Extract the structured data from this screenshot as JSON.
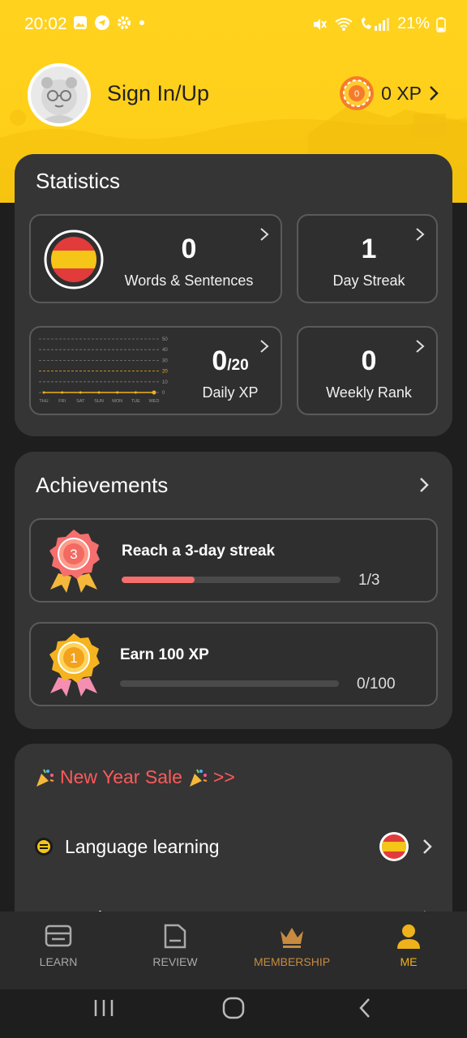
{
  "status_bar": {
    "time": "20:02",
    "battery": "21%"
  },
  "profile": {
    "sign_in_label": "Sign In/Up",
    "xp_label": "0 XP",
    "coin_value": "0"
  },
  "statistics": {
    "title": "Statistics",
    "words": {
      "value": "0",
      "label": "Words & Sentences"
    },
    "streak": {
      "value": "1",
      "label": "Day Streak"
    },
    "daily_xp": {
      "value": "0",
      "goal": "/20",
      "label": "Daily XP"
    },
    "weekly_rank": {
      "value": "0",
      "label": "Weekly Rank"
    },
    "mini_chart": {
      "y_ticks": [
        "50",
        "40",
        "30",
        "20",
        "10",
        "0"
      ],
      "x_days": [
        "THU",
        "FRI",
        "SAT",
        "SUN",
        "MON",
        "TUE",
        "WED"
      ],
      "values": [
        0,
        0,
        0,
        0,
        0,
        0,
        0
      ],
      "goal_tick": "20",
      "line_color": "#f0b21a"
    }
  },
  "achievements": {
    "title": "Achievements",
    "items": [
      {
        "badge": "3",
        "title": "Reach a 3-day streak",
        "count": "1/3",
        "progress": 0.333,
        "color": "#f56f6f"
      },
      {
        "badge": "1",
        "title": "Earn 100 XP",
        "count": "0/100",
        "progress": 0.0,
        "color": "#f0b21a"
      }
    ]
  },
  "menu": {
    "promo": "New Year Sale",
    "promo_suffix": ">>",
    "language_learning": "Language learning",
    "settings": "Settings"
  },
  "bottom_nav": {
    "learn": "LEARN",
    "review": "REVIEW",
    "membership": "MEMBERSHIP",
    "me": "ME"
  },
  "colors": {
    "accent": "#f0b21a",
    "header": "#ffd21e",
    "card": "#353535",
    "promo": "#ff5a5a"
  }
}
